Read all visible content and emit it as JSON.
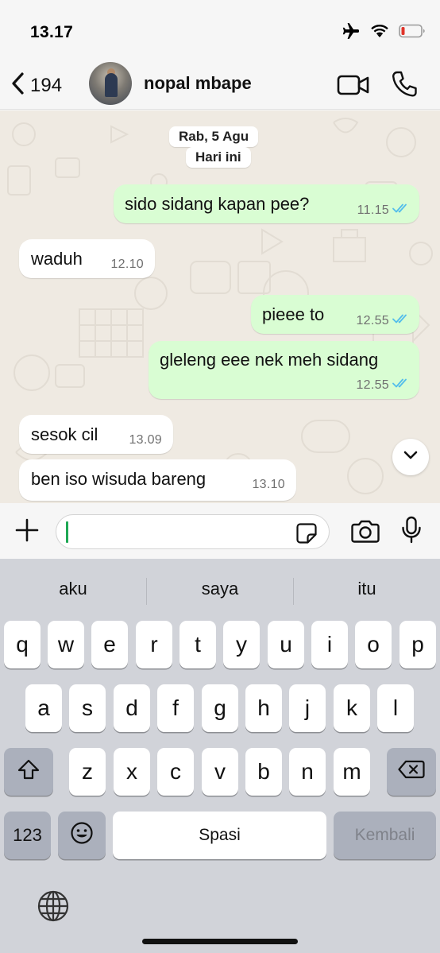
{
  "status_bar": {
    "time": "13.17"
  },
  "header": {
    "back_count": "194",
    "contact_name": "nopal mbape"
  },
  "chat": {
    "date_label": "Rab, 5 Agu",
    "today_label": "Hari ini",
    "messages": [
      {
        "direction": "out",
        "text": "sido sidang kapan pee?",
        "time": "11.15",
        "read": true
      },
      {
        "direction": "in",
        "text": "waduh",
        "time": "12.10"
      },
      {
        "direction": "out",
        "text": "pieee to",
        "time": "12.55",
        "read": true
      },
      {
        "direction": "out",
        "text": "gleleng eee nek meh sidang",
        "time": "12.55",
        "read": true
      },
      {
        "direction": "in",
        "text": "sesok cil",
        "time": "13.09"
      },
      {
        "direction": "in",
        "text": "ben iso wisuda bareng",
        "time": "13.10"
      }
    ]
  },
  "composer": {
    "value": ""
  },
  "keyboard": {
    "suggestions": [
      "aku",
      "saya",
      "itu"
    ],
    "row1": [
      "q",
      "w",
      "e",
      "r",
      "t",
      "y",
      "u",
      "i",
      "o",
      "p"
    ],
    "row2": [
      "a",
      "s",
      "d",
      "f",
      "g",
      "h",
      "j",
      "k",
      "l"
    ],
    "row3": [
      "z",
      "x",
      "c",
      "v",
      "b",
      "n",
      "m"
    ],
    "numbers_label": "123",
    "space_label": "Spasi",
    "return_label": "Kembali"
  },
  "colors": {
    "outgoing_bubble": "#d9fdd3",
    "incoming_bubble": "#ffffff",
    "chat_background": "#efeae2",
    "read_ticks": "#53bdeb",
    "caret": "#1fa855"
  }
}
